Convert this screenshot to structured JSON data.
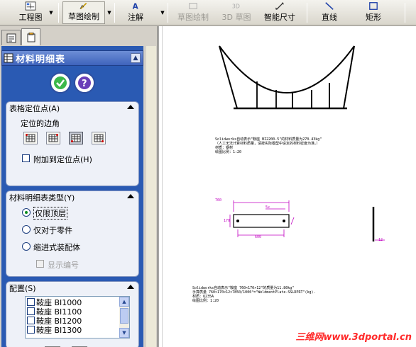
{
  "toolbar": {
    "drawing": "工程图",
    "sketch": "草图绘制",
    "annotation": "注解",
    "sketch_disabled": "草图绘制",
    "sketch3d": "3D 草图",
    "smart_dim": "智能尺寸",
    "line": "直线",
    "rectangle": "矩形"
  },
  "panel": {
    "title": "材料明细表",
    "anchor_group": {
      "title": "表格定位点(A)",
      "subtitle": "定位的边角",
      "attach_label": "附加到定位点(H)"
    },
    "bom_type_group": {
      "title": "材料明细表类型(Y)",
      "options": [
        "仅限顶层",
        "仅对于零件",
        "缩进式装配体"
      ],
      "selected": 0,
      "show_numbering": "显示编号"
    },
    "config_group": {
      "title": "配置(S)",
      "items": [
        "鞍座 BI1000",
        "鞍座 BI1100",
        "鞍座 BI1200",
        "鞍座 BI1300"
      ]
    }
  },
  "drawing": {
    "note1": [
      "Solidworks自动表示\"鞍座 BI2200-5\"的材料质量为270.43kg\"",
      "（人工无法计算材料质量，请按实际模型中设定的材料密度为准。）",
      "材质：钢材",
      "绘图比例：1:20"
    ],
    "note2": [
      "Solidworks自动表示\"鞍座 760×170×12\"的质量为11.80kg\"",
      "手算质量 760×170×12×7850/1000³=\"WeldmentPlate-SSLDPRT\"(kg).",
      "材质：Q235A",
      "绘图比例：1:20"
    ],
    "dims": {
      "top": "760",
      "small": "5x",
      "bottom": "600",
      "side": "170",
      "right": "12"
    },
    "watermark": "三维网www.3dportal.cn"
  }
}
